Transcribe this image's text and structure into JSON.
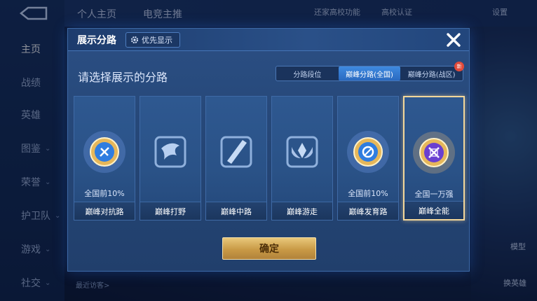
{
  "background": {
    "nav": [
      {
        "label": "主页",
        "active": true
      },
      {
        "label": "战绩",
        "active": false
      },
      {
        "label": "英雄",
        "active": false
      },
      {
        "label": "图鉴",
        "active": false
      },
      {
        "label": "荣誉",
        "active": false
      },
      {
        "label": "护卫队",
        "active": false
      },
      {
        "label": "游戏",
        "active": false
      },
      {
        "label": "社交",
        "active": false
      }
    ],
    "top_tabs": [
      "个人主页",
      "电竞主推"
    ],
    "top_right": {
      "school": "高校认证",
      "settings": "设置",
      "misc": "还家高校功能"
    },
    "bottom_left": "最近访客>",
    "right_labels": {
      "model": "模型",
      "switch_hero": "换英雄"
    }
  },
  "dialog": {
    "title": "展示分路",
    "pref_button": "优先显示",
    "subtitle": "请选择展示的分路",
    "tabs": [
      {
        "label": "分路段位",
        "selected": false,
        "badge": ""
      },
      {
        "label": "巅峰分路(全国)",
        "selected": true,
        "badge": ""
      },
      {
        "label": "巅峰分路(战区)",
        "selected": false,
        "badge": "新"
      }
    ],
    "lanes": [
      {
        "name": "巅峰对抗路",
        "rank": "全国前10%",
        "icon": "clash-lane-icon",
        "selected": false
      },
      {
        "name": "巅峰打野",
        "rank": "",
        "icon": "jungle-icon",
        "selected": false
      },
      {
        "name": "巅峰中路",
        "rank": "",
        "icon": "mid-lane-icon",
        "selected": false
      },
      {
        "name": "巅峰游走",
        "rank": "",
        "icon": "roam-icon",
        "selected": false
      },
      {
        "name": "巅峰发育路",
        "rank": "全国前10%",
        "icon": "farm-lane-icon",
        "selected": false
      },
      {
        "name": "巅峰全能",
        "rank": "全国一万强",
        "icon": "all-round-icon",
        "selected": true
      }
    ],
    "confirm_label": "确定"
  },
  "colors": {
    "gold": "#e8c77a",
    "tab_selected": "#3f8ae0",
    "panel": "#2b4f84",
    "lane_selected_border": "#f3d79a"
  }
}
